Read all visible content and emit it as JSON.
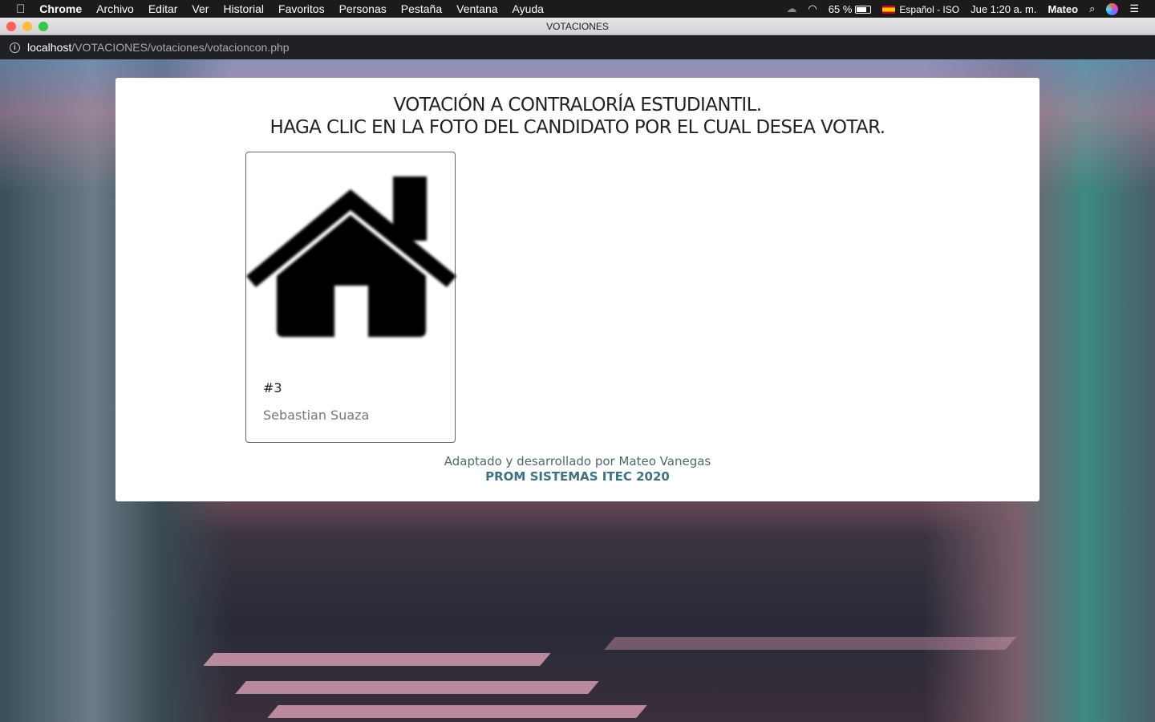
{
  "menubar": {
    "app": "Chrome",
    "items": [
      "Archivo",
      "Editar",
      "Ver",
      "Historial",
      "Favoritos",
      "Personas",
      "Pestaña",
      "Ventana",
      "Ayuda"
    ],
    "battery": "65 %",
    "battery_level": 65,
    "input_source": "Español - ISO",
    "clock": "Jue 1:20 a. m.",
    "user": "Mateo"
  },
  "window": {
    "title": "VOTACIONES"
  },
  "address": {
    "host": "localhost",
    "path": "/VOTACIONES/votaciones/votacioncon.php"
  },
  "page": {
    "title_line1": "VOTACIÓN A CONTRALORÍA ESTUDIANTIL.",
    "title_line2": "HAGA CLIC EN LA FOTO DEL CANDIDATO POR EL CUAL DESEA VOTAR.",
    "candidates": [
      {
        "number": "#3",
        "name": "Sebastian Suaza",
        "photo": "house-icon"
      }
    ],
    "footer_line1": "Adaptado y desarrollado por Mateo Vanegas",
    "footer_line2": "PROM SISTEMAS ITEC 2020"
  }
}
